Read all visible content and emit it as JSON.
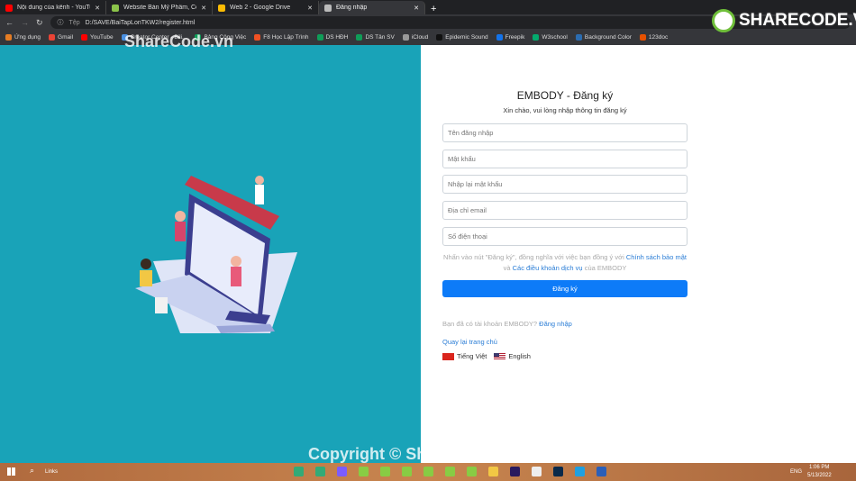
{
  "browser": {
    "tabs": [
      {
        "label": "Nội dung của kênh - YouTube St",
        "color": "#ff0000"
      },
      {
        "label": "Website Bán Mỹ Phẩm, Có Trang",
        "color": "#8bc34a"
      },
      {
        "label": "Web 2 - Google Drive",
        "color": "#fbbc04"
      },
      {
        "label": "Đăng nhập",
        "color": "#bbbbbb",
        "active": true
      }
    ],
    "url_prefix": "Tệp",
    "url": "D:/SAVE/BaiTapLonTKW2/register.html",
    "bookmarks": [
      {
        "label": "Ứng dụng",
        "color": "#e57c23"
      },
      {
        "label": "Gmail",
        "color": "#ea4335"
      },
      {
        "label": "YouTube",
        "color": "#ff0000"
      },
      {
        "label": "Creator Center - Bili...",
        "color": "#4a90e2"
      },
      {
        "label": "Bảng Công Việc",
        "color": "#0f9d58"
      },
      {
        "label": "F8 Học Lập Trình",
        "color": "#f05123"
      },
      {
        "label": "DS HĐH",
        "color": "#0f9d58"
      },
      {
        "label": "DS Tân SV",
        "color": "#0f9d58"
      },
      {
        "label": "iCloud",
        "color": "#999999"
      },
      {
        "label": "Epidemic Sound",
        "color": "#111111"
      },
      {
        "label": "Freepik",
        "color": "#1273eb"
      },
      {
        "label": "W3school",
        "color": "#04aa6d"
      },
      {
        "label": "Background Color",
        "color": "#2b6cb0"
      },
      {
        "label": "123doc",
        "color": "#e65100"
      }
    ]
  },
  "watermark": {
    "top": "ShareCode.vn",
    "bottom": "Copyright © ShareCode.vn",
    "logo": "SHARECODE.VN"
  },
  "form": {
    "title": "EMBODY - Đăng ký",
    "subtitle": "Xin chào, vui lòng nhập thông tin đăng ký",
    "fields": [
      {
        "placeholder": "Tên đăng nhập"
      },
      {
        "placeholder": "Mật khẩu"
      },
      {
        "placeholder": "Nhập lại mật khẩu"
      },
      {
        "placeholder": "Địa chỉ email"
      },
      {
        "placeholder": "Số điện thoại"
      }
    ],
    "terms_prefix": "Nhấn vào nút \"Đăng ký\", đồng nghĩa với việc bạn đồng ý với ",
    "privacy_link": "Chính sách bảo mật",
    "terms_and": " và ",
    "terms_link": "Các điều khoản dịch vụ",
    "terms_suffix": " của EMBODY",
    "submit": "Đăng ký",
    "have_account": "Bạn đã có tài khoản EMBODY? ",
    "login_link": "Đăng nhập",
    "back_home": "Quay lại trang chủ",
    "lang_vi": "Tiếng Việt",
    "lang_en": "English"
  },
  "colors": {
    "left_bg": "#19a3b8",
    "primary": "#0d7bf8"
  },
  "taskbar": {
    "search": "Links",
    "lang": "ENG",
    "time": "1:06 PM",
    "date": "5/13/2022"
  }
}
